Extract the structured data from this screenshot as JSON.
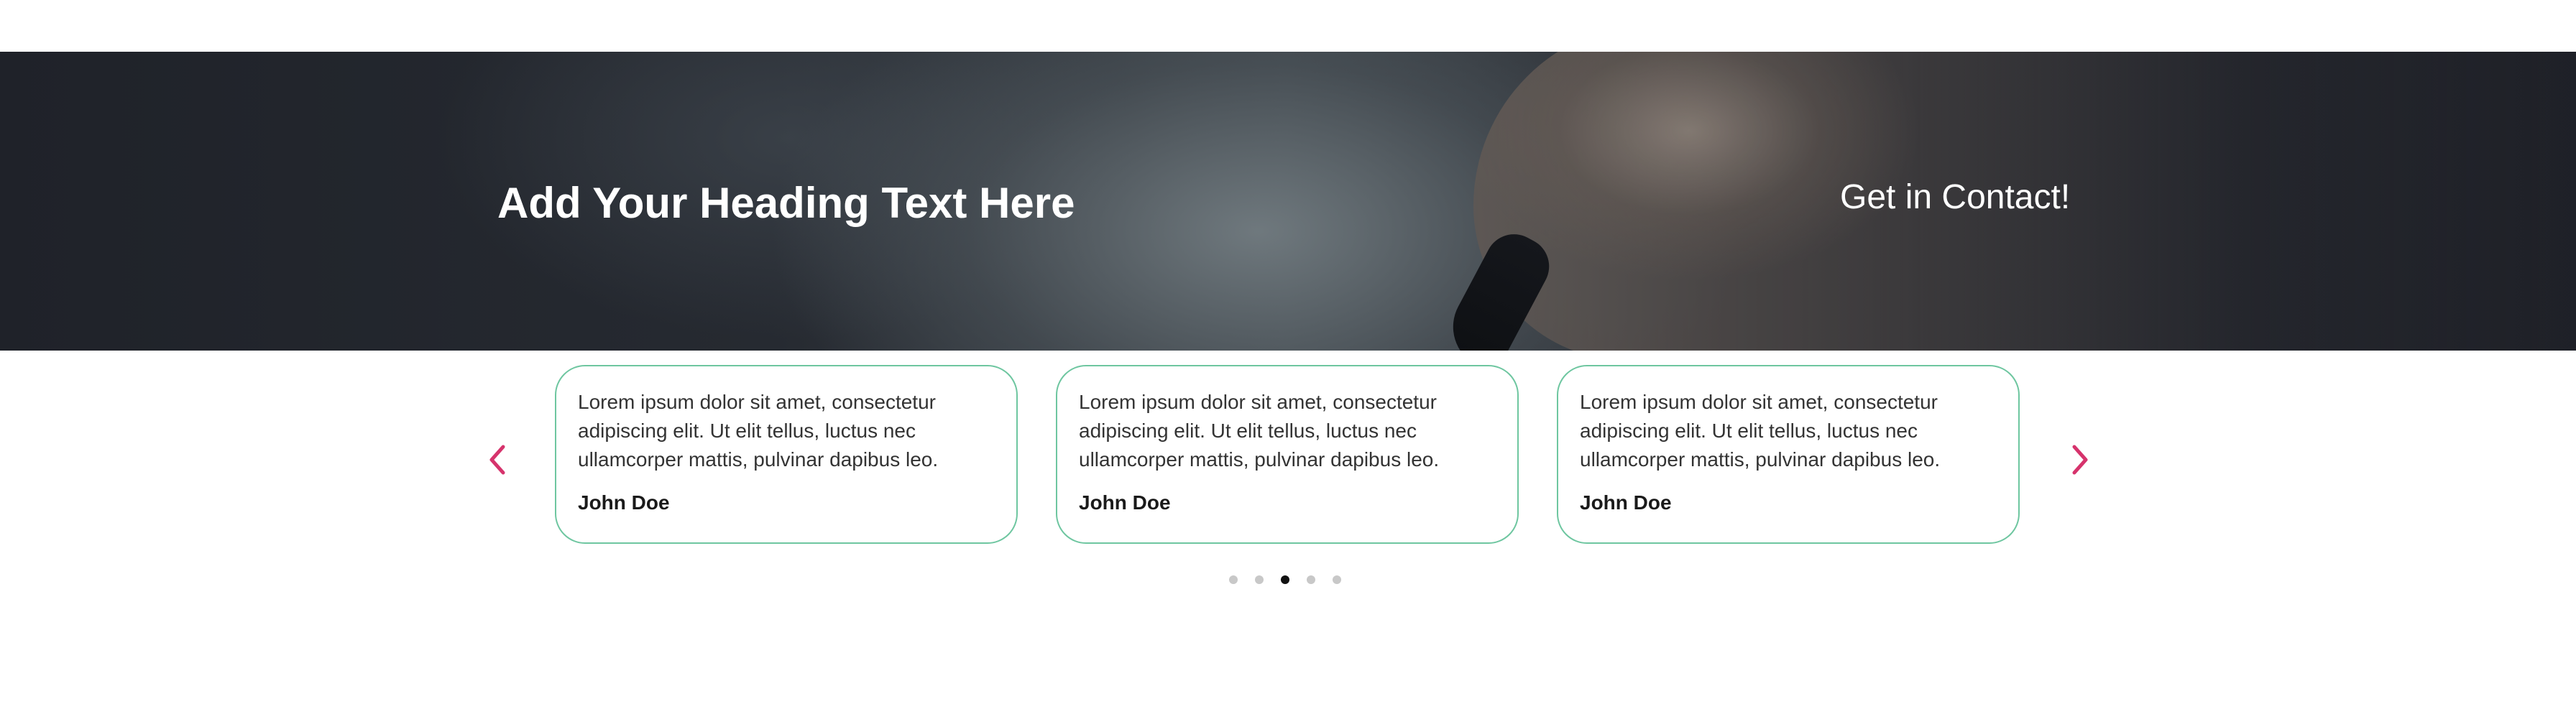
{
  "hero": {
    "heading": "Add Your Heading Text Here",
    "cta_label": "Get in Contact!"
  },
  "carousel": {
    "prev_icon": "chevron-left-icon",
    "next_icon": "chevron-right-icon",
    "arrow_color": "#d6336c",
    "card_border_color": "#6ec6a0",
    "cards": [
      {
        "quote": "Lorem ipsum dolor sit amet, consectetur adipiscing elit. Ut elit tellus, luctus nec ullamcorper mattis, pulvinar dapibus leo.",
        "author": "John Doe"
      },
      {
        "quote": "Lorem ipsum dolor sit amet, consectetur adipiscing elit. Ut elit tellus, luctus nec ullamcorper mattis, pulvinar dapibus leo.",
        "author": "John Doe"
      },
      {
        "quote": "Lorem ipsum dolor sit amet, consectetur adipiscing elit. Ut elit tellus, luctus nec ullamcorper mattis, pulvinar dapibus leo.",
        "author": "John Doe"
      }
    ],
    "pagination": {
      "total": 5,
      "active": 3
    }
  }
}
